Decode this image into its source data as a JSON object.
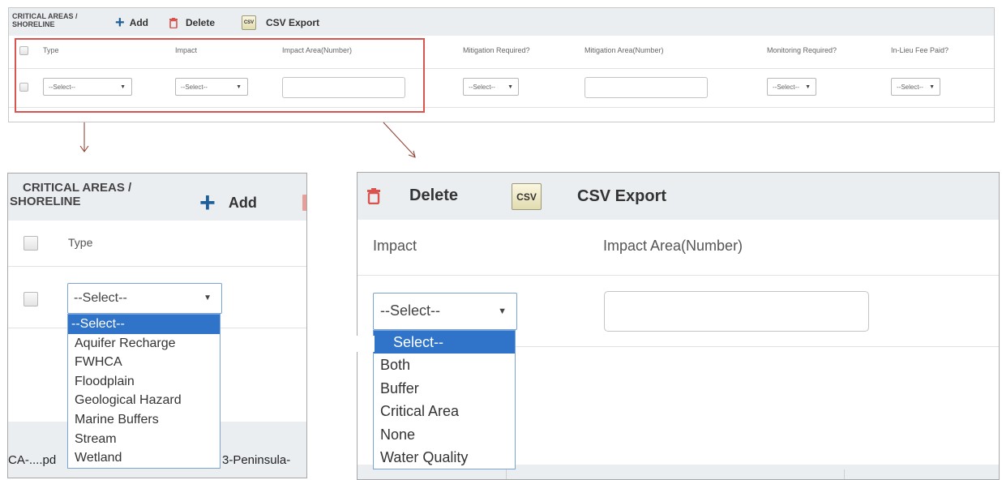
{
  "top": {
    "section_title_line1": "CRITICAL AREAS /",
    "section_title_line2": "SHORELINE",
    "add_label": "Add",
    "delete_label": "Delete",
    "csv_icon_text": "CSV",
    "csv_export_label": "CSV Export",
    "columns": [
      "Type",
      "Impact",
      "Impact Area(Number)",
      "Mitigation Required?",
      "Mitigation Area(Number)",
      "Monitoring Required?",
      "In-Lieu Fee Paid?"
    ],
    "select_value": "--Select--"
  },
  "left_zoom": {
    "section_title_line1": "CRITICAL AREAS /",
    "section_title_line2": "SHORELINE",
    "add_label": "Add",
    "type_header": "Type",
    "select_value": "--Select--",
    "options": [
      "--Select--",
      "Aquifer Recharge",
      "FWHCA",
      "Floodplain",
      "Geological Hazard",
      "Marine Buffers",
      "Stream",
      "Wetland"
    ],
    "bottom_text_left": "CA-....pd",
    "bottom_text_right": "3-Peninsula-"
  },
  "right_zoom": {
    "delete_label": "Delete",
    "csv_icon_text": "CSV",
    "csv_export_label": "CSV Export",
    "impact_header": "Impact",
    "impact_area_header": "Impact Area(Number)",
    "select_value": "--Select--",
    "options": [
      "Select--",
      "Both",
      "Buffer",
      "Critical Area",
      "None",
      "Water Quality"
    ]
  },
  "colors": {
    "add_plus": "#1f5f99",
    "trash": "#d9534f",
    "highlight_border": "#d9534f",
    "selected_option": "#2f74c8",
    "header_bg": "#ebeef1"
  }
}
